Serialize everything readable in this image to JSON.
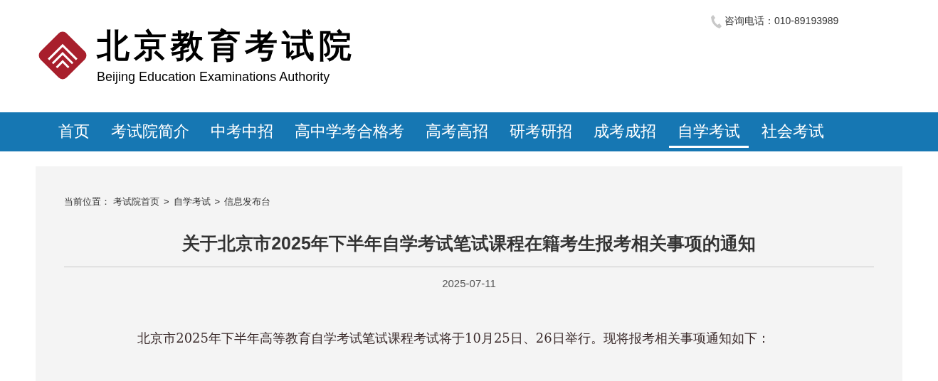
{
  "header": {
    "logo_title": "北京教育考试院",
    "logo_subtitle": "Beijing Education Examinations Authority",
    "hotline": "咨询电话：010-89193989"
  },
  "nav": [
    {
      "label": "首页",
      "selected": false
    },
    {
      "label": "考试院简介",
      "selected": false
    },
    {
      "label": "中考中招",
      "selected": false
    },
    {
      "label": "高中学考合格考",
      "selected": false
    },
    {
      "label": "高考高招",
      "selected": false
    },
    {
      "label": "研考研招",
      "selected": false
    },
    {
      "label": "成考成招",
      "selected": false
    },
    {
      "label": "自学考试",
      "selected": true
    },
    {
      "label": "社会考试",
      "selected": false
    }
  ],
  "breadcrumb": {
    "label": "当前位置：",
    "items": [
      {
        "kind": "link",
        "text": "考试院首页"
      },
      {
        "kind": "separator",
        "text": ">"
      },
      {
        "kind": "link",
        "text": "自学考试"
      },
      {
        "kind": "separator",
        "text": ">"
      },
      {
        "kind": "link",
        "text": "信息发布台"
      }
    ]
  },
  "article": {
    "title": "关于北京市2025年下半年自学考试笔试课程在籍考生报考相关事项的通知",
    "date": "2025-07-11",
    "paragraphs": [
      "北京市2025年下半年高等教育自学考试笔试课程考试将于10月25日、26日举行。现将报考相关事项通知如下："
    ]
  }
}
